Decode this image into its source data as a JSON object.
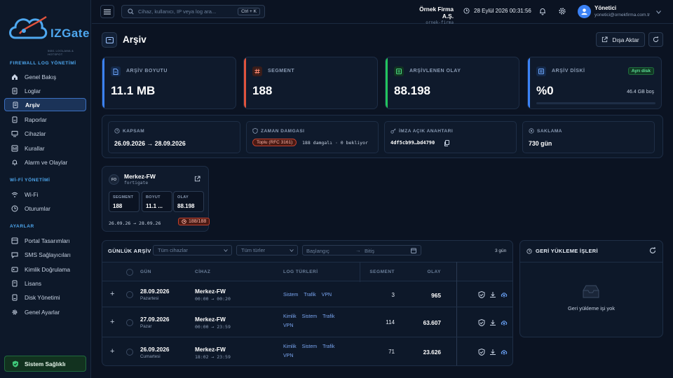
{
  "brand": {
    "logo_text": "IZGate",
    "tagline": "5651 LOGLAMA & HOTSPOT"
  },
  "sidebar": {
    "sections": [
      {
        "title": "FIREWALL LOG YÖNETİMİ",
        "items": [
          "Genel Bakış",
          "Loglar",
          "Arşiv",
          "Raporlar",
          "Cihazlar",
          "Kurallar",
          "Alarm ve Olaylar"
        ]
      },
      {
        "title": "Wİ-Fİ YÖNETİMİ",
        "items": [
          "Wi-Fi",
          "Oturumlar"
        ]
      },
      {
        "title": "AYARLAR",
        "items": [
          "Portal Tasarımları",
          "SMS Sağlayıcıları",
          "Kimlik Doğrulama",
          "Lisans",
          "Disk Yönetimi",
          "Genel Ayarlar"
        ]
      }
    ],
    "active_item": "Arşiv",
    "health_label": "Sistem Sağlıklı"
  },
  "topbar": {
    "search_placeholder": "Cihaz, kullanıcı, IP veya log ara...",
    "search_shortcut": "Ctrl + K",
    "company_name": "Örnek Firma A.Ş.",
    "company_slug": "ornek-firma",
    "datetime": "28 Eylül 2026 00:31:56",
    "user_name": "Yönetici",
    "user_email": "yonetici@ornekfirma.com.tr"
  },
  "page": {
    "title": "Arşiv",
    "export_label": "Dışa Aktar"
  },
  "stats": [
    {
      "label": "ARŞİV BOYUTU",
      "value": "11.1 MB",
      "accent": "#3b82f6",
      "icon": "file-icon"
    },
    {
      "label": "SEGMENT",
      "value": "188",
      "accent": "#e0533d",
      "icon": "hash-icon"
    },
    {
      "label": "ARŞİVLENEN OLAY",
      "value": "88.198",
      "accent": "#22c55e",
      "icon": "list-icon"
    },
    {
      "label": "ARŞİV DİSKİ",
      "value": "%0",
      "accent": "#3b82f6",
      "icon": "disk-icon",
      "badge": "Ayrı disk",
      "free": "46.4 GB boş",
      "usage_percent": 0
    }
  ],
  "info": {
    "scope": {
      "label": "KAPSAM",
      "value": "26.09.2026 → 28.09.2026"
    },
    "timestamp": {
      "label": "ZAMAN DAMGASI",
      "badge": "Toplu (RFC 3161)",
      "note": "188 damgalı · 0 bekliyor"
    },
    "key": {
      "label": "İMZA AÇIK ANAHTARI",
      "value": "4df5cb99…bd4790"
    },
    "retention": {
      "label": "SAKLAMA",
      "value": "730 gün"
    }
  },
  "device": {
    "badge": "FO",
    "name": "Merkez-FW",
    "type": "fortigate",
    "stats": [
      {
        "label": "SEGMENT",
        "value": "188"
      },
      {
        "label": "BOYUT",
        "value": "11.1 ..."
      },
      {
        "label": "OLAY",
        "value": "88.198"
      }
    ],
    "range": "26.09.26 → 28.09.26",
    "count": "188/188"
  },
  "daily": {
    "title": "GÜNLÜK ARŞİV",
    "device_filter": "Tüm cihazlar",
    "type_filter": "Tüm türler",
    "start_placeholder": "Başlangıç",
    "end_placeholder": "Bitiş",
    "day_count": "3 gün",
    "columns": [
      "GÜN",
      "CİHAZ",
      "LOG TÜRLERİ",
      "SEGMENT",
      "OLAY"
    ],
    "rows": [
      {
        "day": "28.09.2026",
        "weekday": "Pazartesi",
        "device": "Merkez-FW",
        "time": "00:00 → 00:20",
        "tags": [
          "Sistem",
          "Trafik",
          "VPN"
        ],
        "segment": "3",
        "events": "965"
      },
      {
        "day": "27.09.2026",
        "weekday": "Pazar",
        "device": "Merkez-FW",
        "time": "00:00 → 23:59",
        "tags": [
          "Kimlik",
          "Sistem",
          "Trafik",
          "VPN"
        ],
        "segment": "114",
        "events": "63.607"
      },
      {
        "day": "26.09.2026",
        "weekday": "Cumartesi",
        "device": "Merkez-FW",
        "time": "18:02 → 23:59",
        "tags": [
          "Kimlik",
          "Sistem",
          "Trafik",
          "VPN"
        ],
        "segment": "71",
        "events": "23.626"
      }
    ]
  },
  "reload": {
    "title": "GERİ YÜKLEME İŞLERİ",
    "empty": "Geri yükleme işi yok"
  }
}
